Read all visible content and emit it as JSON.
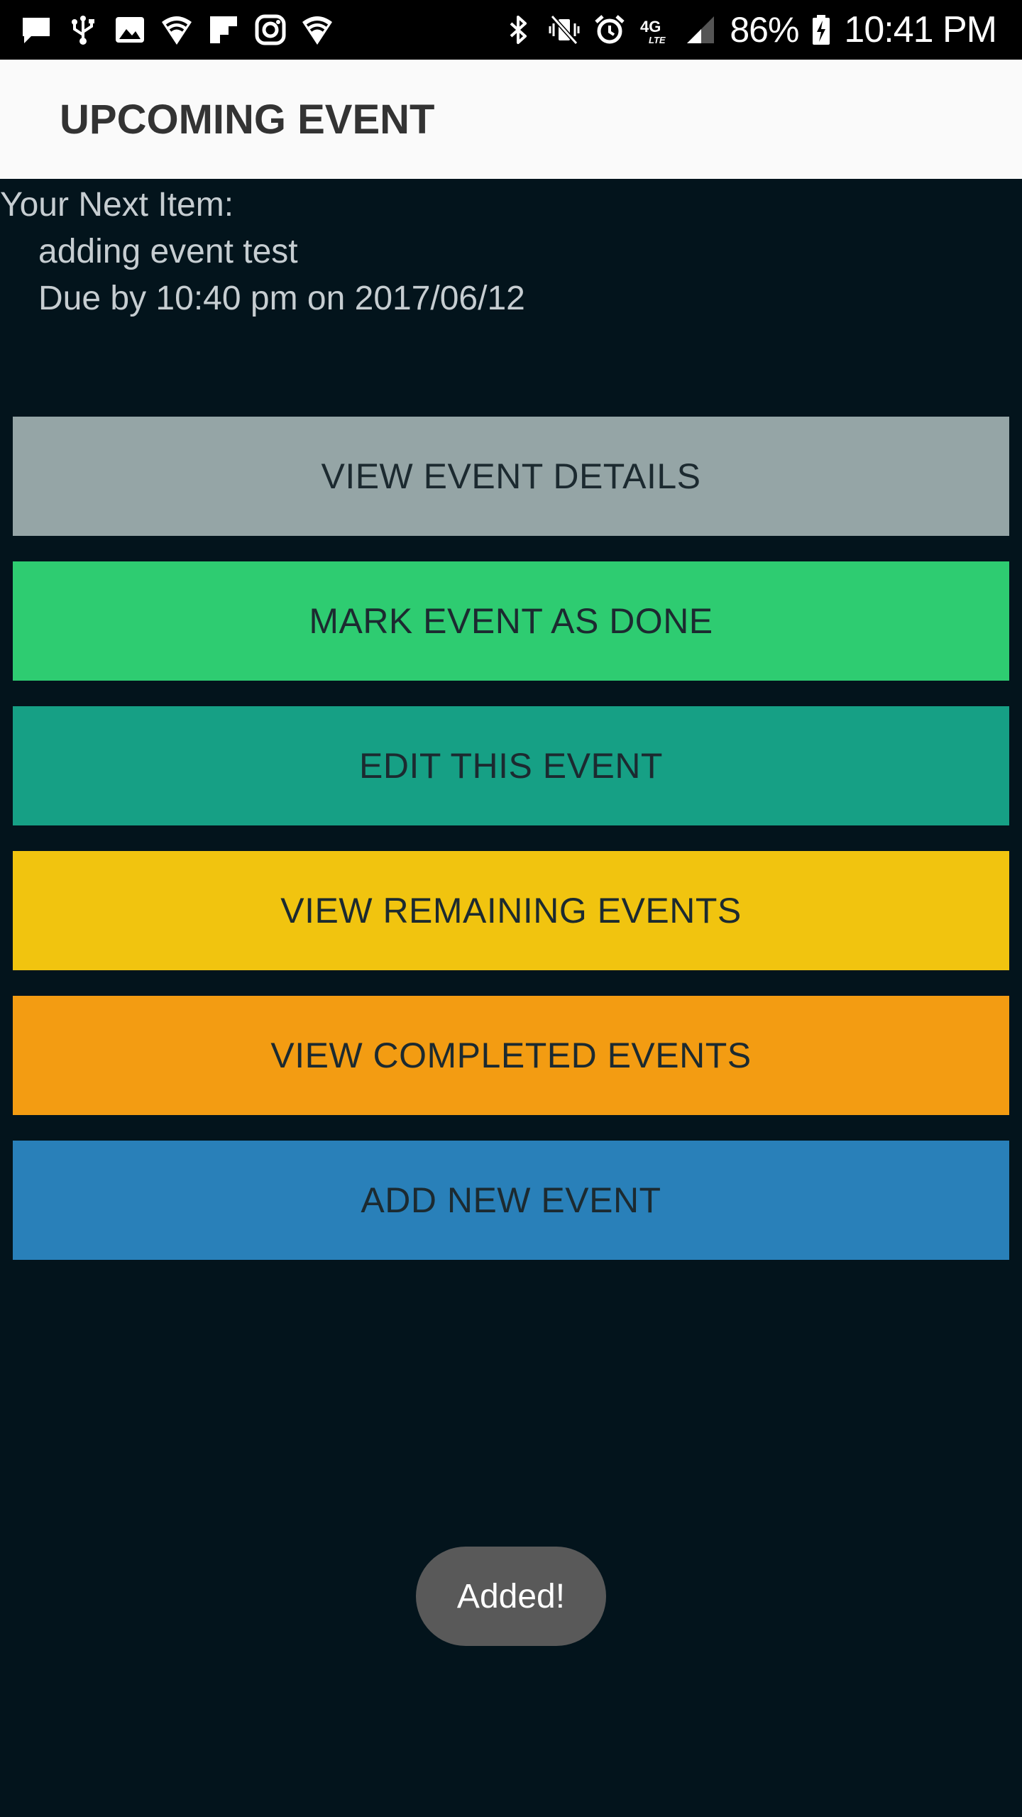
{
  "status_bar": {
    "left_icons": [
      "message-icon",
      "usb-icon",
      "image-icon",
      "wifi-shield-icon",
      "flipboard-icon",
      "instagram-icon",
      "wifi-shield-icon"
    ],
    "right_icons": [
      "bluetooth-icon",
      "vibrate-mute-icon",
      "alarm-icon",
      "4g-lte-icon",
      "signal-icon",
      "battery-charging-icon"
    ],
    "network_label": "4G",
    "battery_percent": "86%",
    "time": "10:41 PM"
  },
  "app_bar": {
    "title": "UPCOMING EVENT"
  },
  "next_item": {
    "label": "Your Next Item:",
    "name": "adding event test",
    "due": "Due by 10:40 pm on 2017/06/12"
  },
  "buttons": {
    "view_details": "VIEW EVENT DETAILS",
    "mark_done": "MARK EVENT AS DONE",
    "edit": "EDIT THIS EVENT",
    "view_remaining": "VIEW REMAINING EVENTS",
    "view_completed": "VIEW COMPLETED EVENTS",
    "add_new": "ADD NEW EVENT"
  },
  "toast": {
    "message": "Added!"
  },
  "colors": {
    "background": "#03141c",
    "app_bar": "#fafafa",
    "view_details": "#95a5a6",
    "mark_done": "#2ecc71",
    "edit": "#16a085",
    "view_remaining": "#f1c40f",
    "view_completed": "#f39c12",
    "add_new": "#2980b9",
    "toast": "#595959"
  }
}
